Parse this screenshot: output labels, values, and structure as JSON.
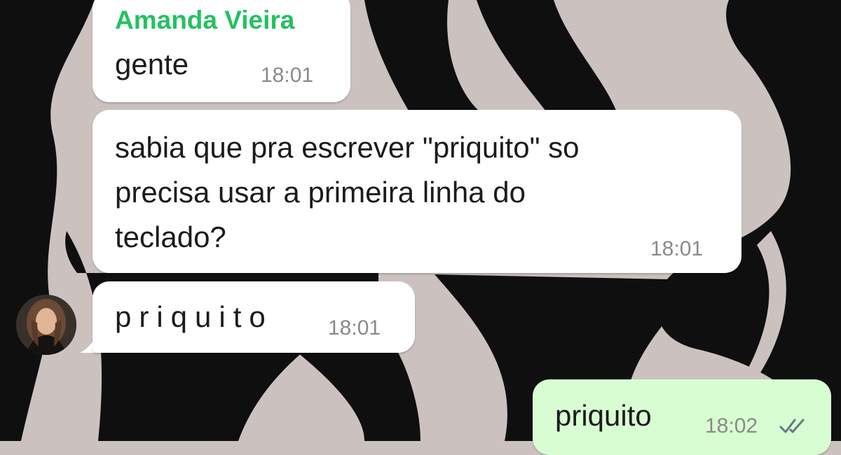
{
  "chat": {
    "background": {
      "style": "black and light-grey zebra stripe wallpaper",
      "dark_color": "#0f0f0f",
      "light_color": "#cbc2c0"
    },
    "messages": [
      {
        "sender": "Amanda Vieira",
        "sender_color": "#25c063",
        "text": "gente",
        "time": "18:01",
        "direction": "incoming"
      },
      {
        "lines": [
          "sabia que pra escrever \"priquito\" so",
          "precisa usar a primeira linha do",
          "teclado?"
        ],
        "time": "18:01",
        "direction": "incoming"
      },
      {
        "text": "priquito",
        "time": "18:01",
        "direction": "incoming",
        "avatar_icon": "user-avatar-icon"
      },
      {
        "text": "priquito",
        "time": "18:02",
        "direction": "outgoing",
        "status": "read",
        "status_icon": "double-check-icon"
      }
    ],
    "colors": {
      "incoming_bubble": "#ffffff",
      "outgoing_bubble": "#d9fdd3",
      "timestamp": "#8a8a8a",
      "read_ticks": "#667781"
    }
  }
}
